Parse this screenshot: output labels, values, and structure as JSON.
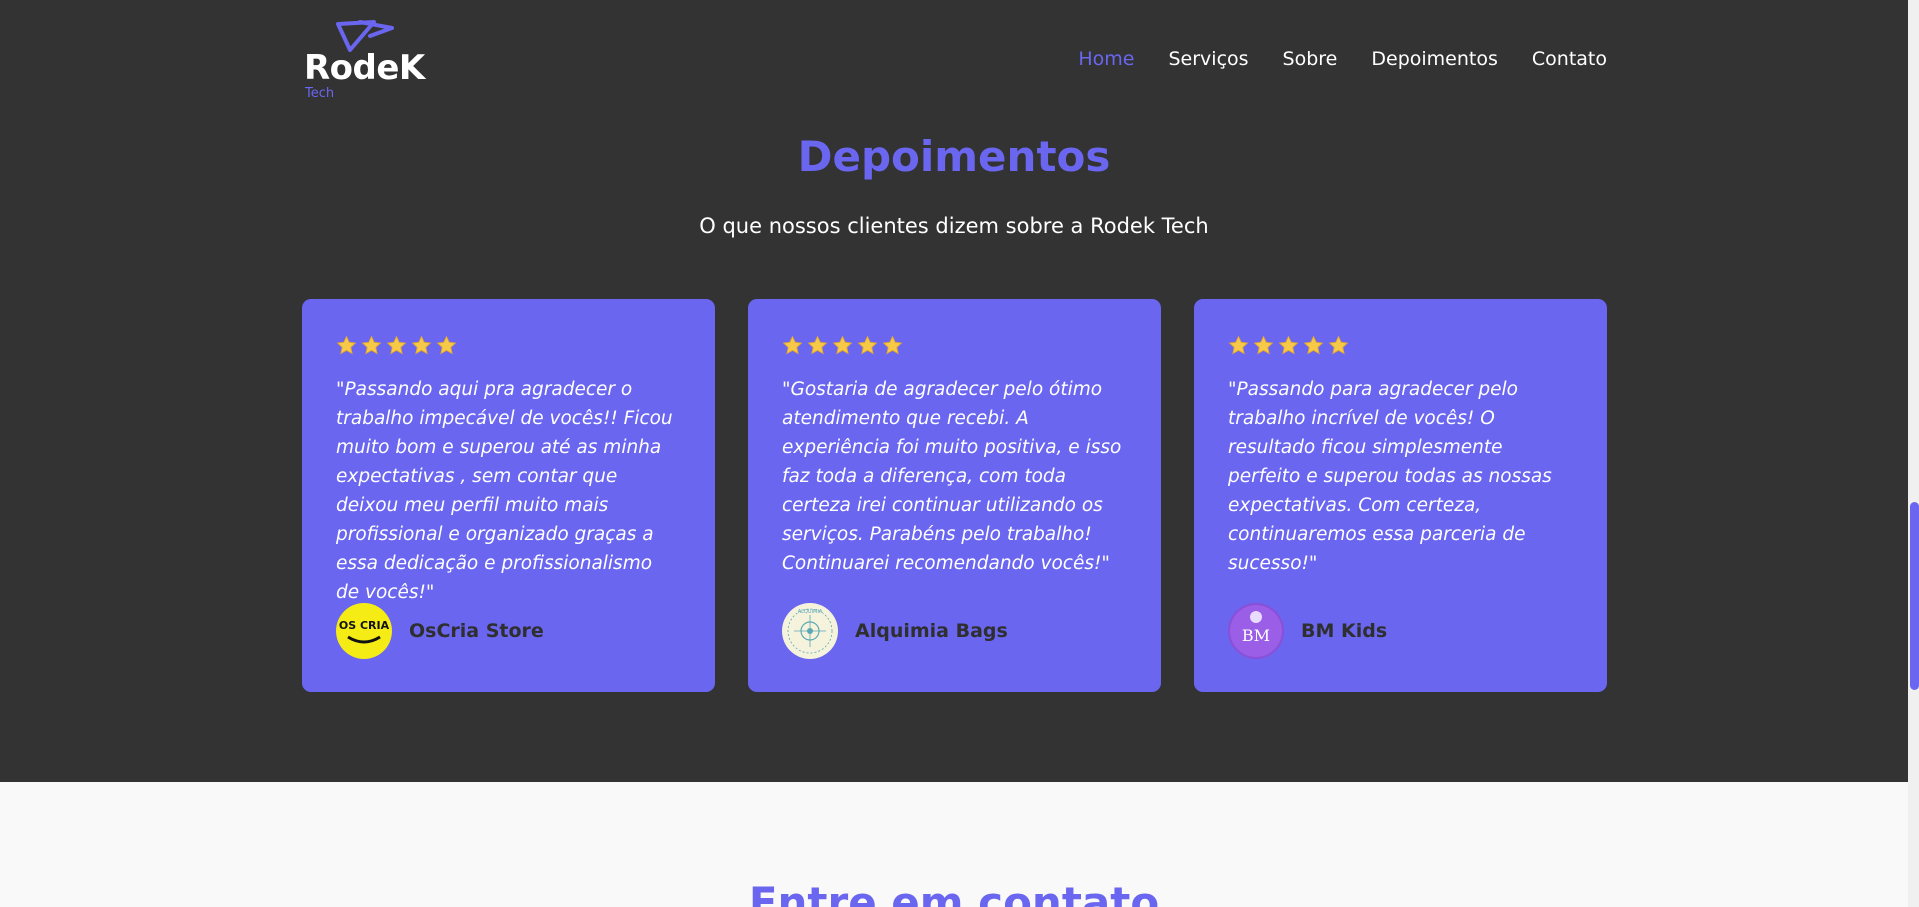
{
  "brand": {
    "name": "RodeK",
    "sub": "Tech",
    "accent": "#6a66f0"
  },
  "nav": [
    {
      "label": "Home",
      "active": true
    },
    {
      "label": "Serviços",
      "active": false
    },
    {
      "label": "Sobre",
      "active": false
    },
    {
      "label": "Depoimentos",
      "active": false
    },
    {
      "label": "Contato",
      "active": false
    }
  ],
  "testimonials": {
    "title": "Depoimentos",
    "subtitle": "O que nossos clientes dizem sobre a Rodek Tech",
    "rating": 5,
    "cards": [
      {
        "quote": "\"Passando aqui pra agradecer o trabalho impecável de vocês!! Ficou muito bom e superou até as minha expectativas , sem contar que deixou meu perfil muito mais profissional e organizado graças a essa dedicação e profissionalismo de vocês!\"",
        "author": "OsCria Store",
        "avatar_text": "OS CRIA"
      },
      {
        "quote": "\"Gostaria de agradecer pelo ótimo atendimento que recebi. A experiência foi muito positiva, e isso faz toda a diferença, com toda certeza irei continuar utilizando os serviços. Parabéns pelo trabalho! Continuarei recomendando vocês!\"",
        "author": "Alquimia Bags",
        "avatar_text": "ALQUIMIA"
      },
      {
        "quote": "\"Passando para agradecer pelo trabalho incrível de vocês! O resultado ficou simplesmente perfeito e superou todas as nossas expectativas. Com certeza, continuaremos essa parceria de sucesso!\"",
        "author": "BM Kids",
        "avatar_text": "BM"
      }
    ]
  },
  "contact": {
    "title": "Entre em contato"
  }
}
